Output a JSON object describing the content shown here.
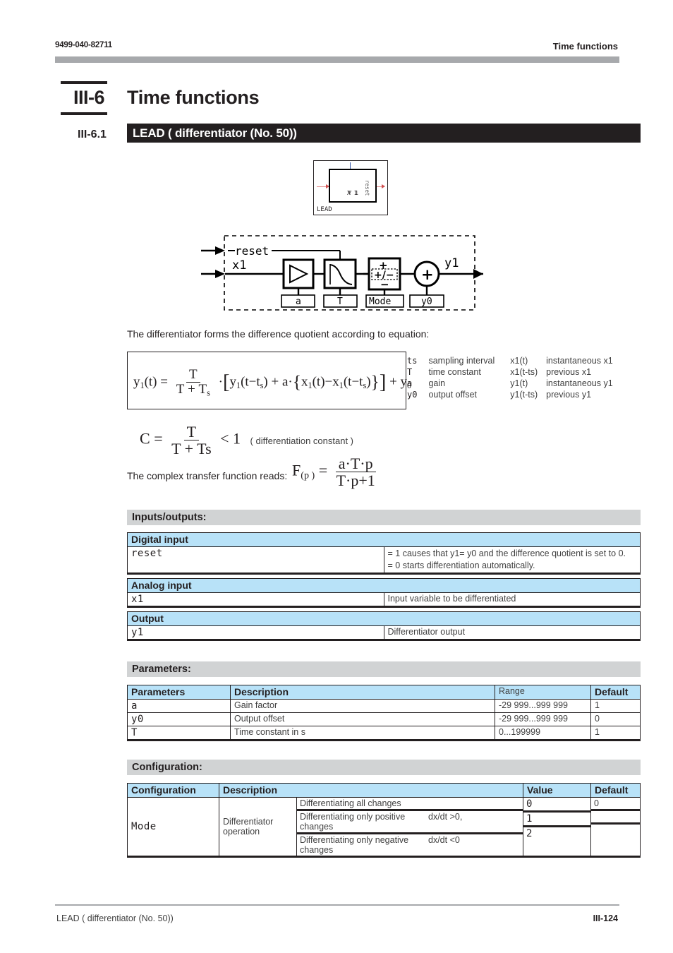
{
  "header": {
    "doc_number": "9499-040-82711",
    "section_title": "Time functions"
  },
  "chapter": {
    "number": "III-6",
    "title": "Time functions"
  },
  "section": {
    "number": "III-6.1",
    "title": "LEAD ( differentiator (No. 50))"
  },
  "block_symbol": {
    "input_label": "X 1",
    "output_label": "Y 1",
    "top_input_label": "reset",
    "block_name": "LEAD"
  },
  "flow_diagram": {
    "reset_label": "reset",
    "x1_label": "x1",
    "y1_label": "y1",
    "gain_param": "a",
    "time_param": "T",
    "mode_param": "Mode",
    "offset_param": "y0",
    "mode_plus": "+",
    "mode_middle": "+/−",
    "mode_minus": "−",
    "sum_symbol": "+"
  },
  "intro_text": "The differentiator forms the difference quotient according to equation:",
  "equation": {
    "lhs": "y",
    "lhs_sub": "1",
    "description": "y1(t) = T/(T+Ts) · [ y1(t−ts) + a · { x1(t) − x1(t−ts) } ] + y0"
  },
  "legend": {
    "rows": [
      {
        "symbol": "ts",
        "description": "sampling interval",
        "symbol2": "x1(t)",
        "description2": "instantaneous x1"
      },
      {
        "symbol": "T",
        "description": "time constant",
        "symbol2": "x1(t-ts)",
        "description2": "previous x1"
      },
      {
        "symbol": "a",
        "description": "gain",
        "symbol2": "y1(t)",
        "description2": "instantaneous   y1"
      },
      {
        "symbol": "y0",
        "description": "output offset",
        "symbol2": "y1(t-ts)",
        "description2": "previous y1"
      }
    ]
  },
  "constant_equation": {
    "lhs": "C",
    "equals": "=",
    "numerator": "T",
    "denominator": "T + Ts",
    "comparison": "< 1",
    "note": "( differentiation constant )"
  },
  "transfer_function": {
    "lead_text": "The complex transfer function reads:",
    "lhs": "F",
    "lhs_sub": "(p )",
    "equals": "=",
    "numerator": "a·T·p",
    "denominator": "T·p+1"
  },
  "io_section": {
    "band_title": "Inputs/outputs:",
    "tables": [
      {
        "header": "Digital input",
        "symbol": "reset",
        "description_lines": [
          "= 1 causes that  y1= y0 and the difference quotient is set to 0.",
          "= 0 starts differentiation automatically."
        ]
      },
      {
        "header": "Analog input",
        "symbol": "x1",
        "description_lines": [
          "Input variable to be differentiated"
        ]
      },
      {
        "header": "Output",
        "symbol": "y1",
        "description_lines": [
          "Differentiator output"
        ]
      }
    ]
  },
  "parameters_section": {
    "band_title": "Parameters:",
    "columns": [
      "Parameters",
      "Description",
      "Range",
      "Default"
    ],
    "rows": [
      {
        "parameter": "a",
        "description": "Gain factor",
        "range": "-29 999...999 999",
        "default": "1"
      },
      {
        "parameter": "y0",
        "description": "Output offset",
        "range": "-29 999...999 999",
        "default": "0"
      },
      {
        "parameter": "T",
        "description": "Time constant in s",
        "range": "0...199999",
        "default": "1"
      }
    ]
  },
  "configuration_section": {
    "band_title": "Configuration:",
    "columns": [
      "Configuration",
      "Description",
      "Value",
      "Default"
    ],
    "config_name": "Mode",
    "description_line1": "Differentiator",
    "description_line2": "operation",
    "options": [
      {
        "text": "Differentiating all changes",
        "dxdt": "",
        "value": "0",
        "default": "0"
      },
      {
        "text": "Differentiating only positive changes",
        "dxdt": "dx/dt >0,",
        "value": "1",
        "default": ""
      },
      {
        "text": "Differentiating only negative changes",
        "dxdt": "dx/dt <0",
        "value": "2",
        "default": ""
      }
    ]
  },
  "footer": {
    "left": "LEAD ( differentiator (No. 50))",
    "right": "III-124"
  }
}
